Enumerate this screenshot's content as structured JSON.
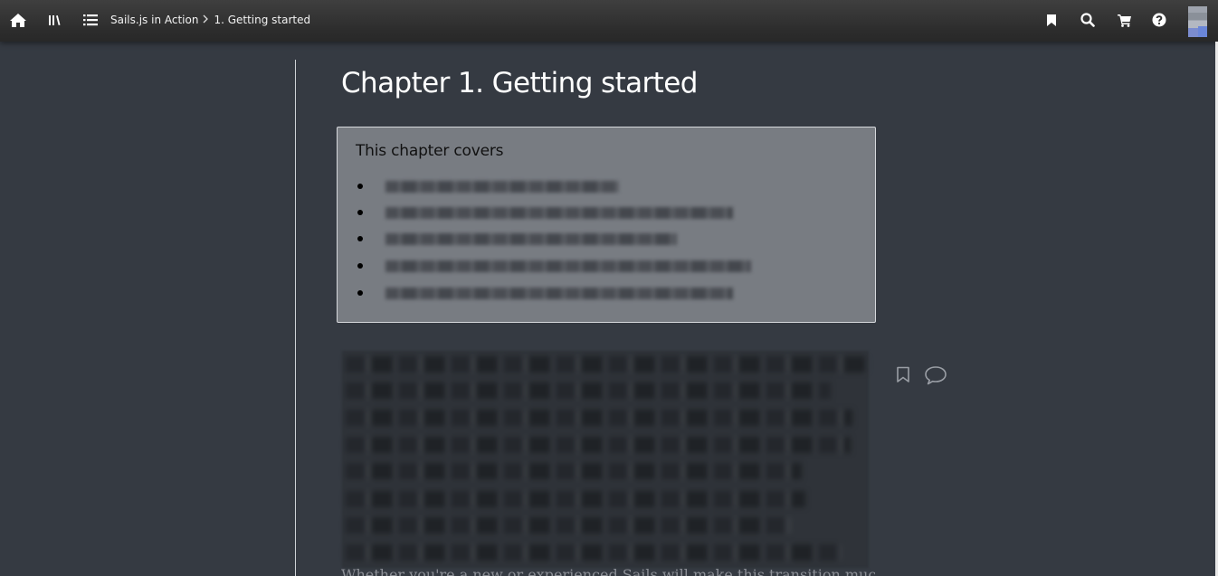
{
  "toolbar": {
    "home_icon": "home-icon",
    "library_icon": "library-icon",
    "toc_icon": "list-icon",
    "bookmark_icon": "bookmark-icon",
    "search_icon": "search-icon",
    "cart_icon": "cart-icon",
    "help_icon": "help-icon"
  },
  "breadcrumb": {
    "book": "Sails.js in Action",
    "separator": ">",
    "chapter": "1. Getting started"
  },
  "content": {
    "chapter_title": "Chapter 1. Getting started",
    "covers_heading": "This chapter covers",
    "covers_items": [
      "",
      "",
      "",
      "",
      ""
    ],
    "paragraph_icons": [
      "bookmark-outline-icon",
      "comment-icon"
    ],
    "bottom_text": "Whether you're a new or experienced Sails will make this transition much"
  },
  "colors": {
    "background": "#353a42",
    "topbar": "#2d2d2d",
    "covers_box": "#787c82"
  }
}
